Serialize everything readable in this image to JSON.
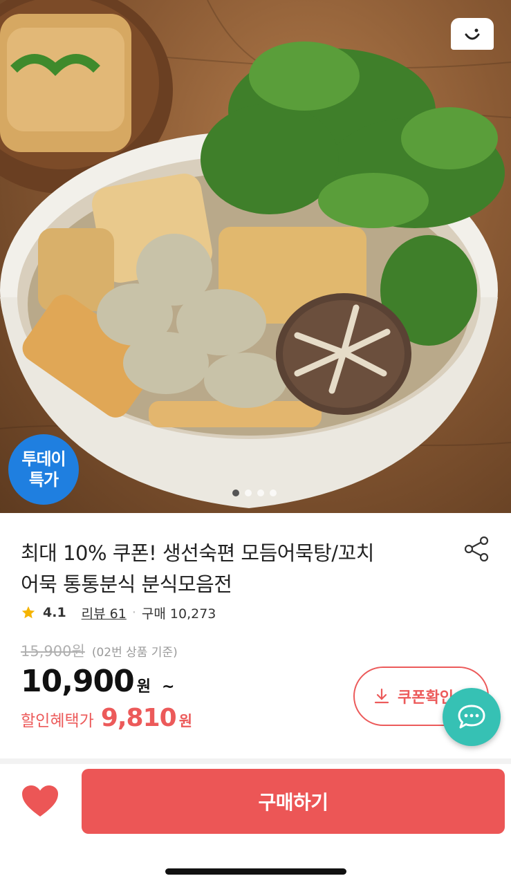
{
  "hero": {
    "badge_line1": "투데이",
    "badge_line2": "특가",
    "carousel": {
      "count": 4,
      "active": 0
    },
    "colors": {
      "badge": "#1f7fe0"
    }
  },
  "product": {
    "title_line1": "최대 10% 쿠폰! 생선숙편 모듬어묵탕/꼬치",
    "title_line2": "어묵 통통분식 분식모음전",
    "rating": "4.1",
    "review_label": "리뷰 61",
    "separator": "·",
    "purchase_label": "구매 10,273",
    "original_price": "15,900원",
    "original_note": "(02번 상품 기준)",
    "price": "10,900",
    "price_unit": "원",
    "price_suffix": "~",
    "discount_label": "할인혜택가",
    "discount_price": "9,810",
    "discount_unit": "원"
  },
  "actions": {
    "coupon_label": "쿠폰확인",
    "buy_label": "구매하기"
  },
  "icons": {
    "share": "share-icon",
    "star": "star-icon",
    "download": "download-icon",
    "chat": "chat-icon",
    "heart": "heart-icon",
    "brand": "brand-logo-icon"
  },
  "colors": {
    "accent": "#ec5656",
    "star": "#f5b400",
    "chat": "#36c1b4"
  }
}
